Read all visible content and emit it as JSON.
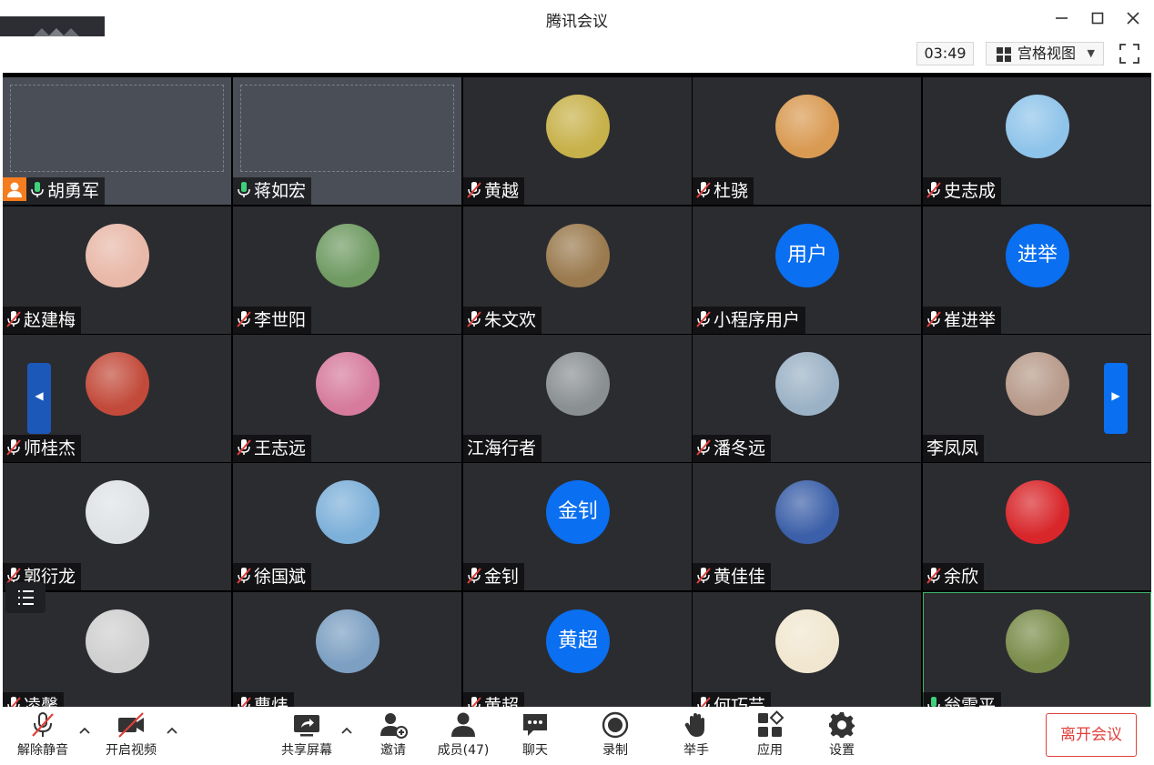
{
  "window": {
    "title": "腾讯会议"
  },
  "topbar": {
    "timer": "03:49",
    "view_label": "宫格视图"
  },
  "participants": [
    {
      "name": "胡勇军",
      "mic": "on",
      "host": true,
      "video": true
    },
    {
      "name": "蒋如宏",
      "mic": "on",
      "video": true
    },
    {
      "name": "黄越",
      "mic": "muted",
      "avatar": "photo",
      "color": "#c7b14a"
    },
    {
      "name": "杜骁",
      "mic": "muted",
      "avatar": "photo",
      "color": "#d99a52"
    },
    {
      "name": "史志成",
      "mic": "muted",
      "avatar": "photo",
      "color": "#8fc4ea"
    },
    {
      "name": "赵建梅",
      "mic": "muted",
      "avatar": "photo",
      "color": "#e8b8a8"
    },
    {
      "name": "李世阳",
      "mic": "muted",
      "avatar": "photo",
      "color": "#6f9a62"
    },
    {
      "name": "朱文欢",
      "mic": "muted",
      "avatar": "photo",
      "color": "#9a7a4e"
    },
    {
      "name": "小程序用户",
      "mic": "muted",
      "avatar_text": "用户"
    },
    {
      "name": "崔进举",
      "mic": "muted",
      "avatar_text": "进举"
    },
    {
      "name": "师桂杰",
      "mic": "muted",
      "avatar": "photo",
      "color": "#c24a3a"
    },
    {
      "name": "王志远",
      "mic": "muted",
      "avatar": "photo",
      "color": "#d67b9c"
    },
    {
      "name": "江海行者",
      "mic": "none",
      "avatar": "photo",
      "color": "#8a8f92"
    },
    {
      "name": "潘冬远",
      "mic": "muted",
      "avatar": "photo",
      "color": "#9bb2c6"
    },
    {
      "name": "李凤凤",
      "mic": "none",
      "avatar": "photo",
      "color": "#b79a8a"
    },
    {
      "name": "郭衍龙",
      "mic": "muted",
      "avatar": "photo",
      "color": "#dfe2e5"
    },
    {
      "name": "徐国斌",
      "mic": "muted",
      "avatar": "photo",
      "color": "#7db0d9"
    },
    {
      "name": "金钊",
      "mic": "muted",
      "avatar_text": "金钊"
    },
    {
      "name": "黄佳佳",
      "mic": "muted",
      "avatar": "photo",
      "color": "#3b5fa8"
    },
    {
      "name": "余欣",
      "mic": "muted",
      "avatar": "photo",
      "color": "#d8262a"
    },
    {
      "name": "凌馨",
      "mic": "muted",
      "avatar": "photo",
      "color": "#cfcfcf"
    },
    {
      "name": "曹炜",
      "mic": "muted",
      "avatar": "photo",
      "color": "#7c9fc2"
    },
    {
      "name": "黄超",
      "mic": "muted",
      "avatar_text": "黄超"
    },
    {
      "name": "何巧芸",
      "mic": "muted",
      "avatar": "photo",
      "color": "#f1e7d0"
    },
    {
      "name": "翁雪平",
      "mic": "on",
      "avatar": "photo",
      "color": "#7a8c4a",
      "active": true
    }
  ],
  "toolbar": {
    "unmute": "解除静音",
    "start_video": "开启视频",
    "share_screen": "共享屏幕",
    "invite": "邀请",
    "members": "成员(47)",
    "chat": "聊天",
    "record": "录制",
    "raise_hand": "举手",
    "apps": "应用",
    "settings": "设置",
    "leave": "离开会议"
  },
  "colors": {
    "accent": "#0a6ff0",
    "host_badge": "#f57c1f",
    "leave": "#e0413b",
    "tile_bg": "#2b2c30"
  }
}
